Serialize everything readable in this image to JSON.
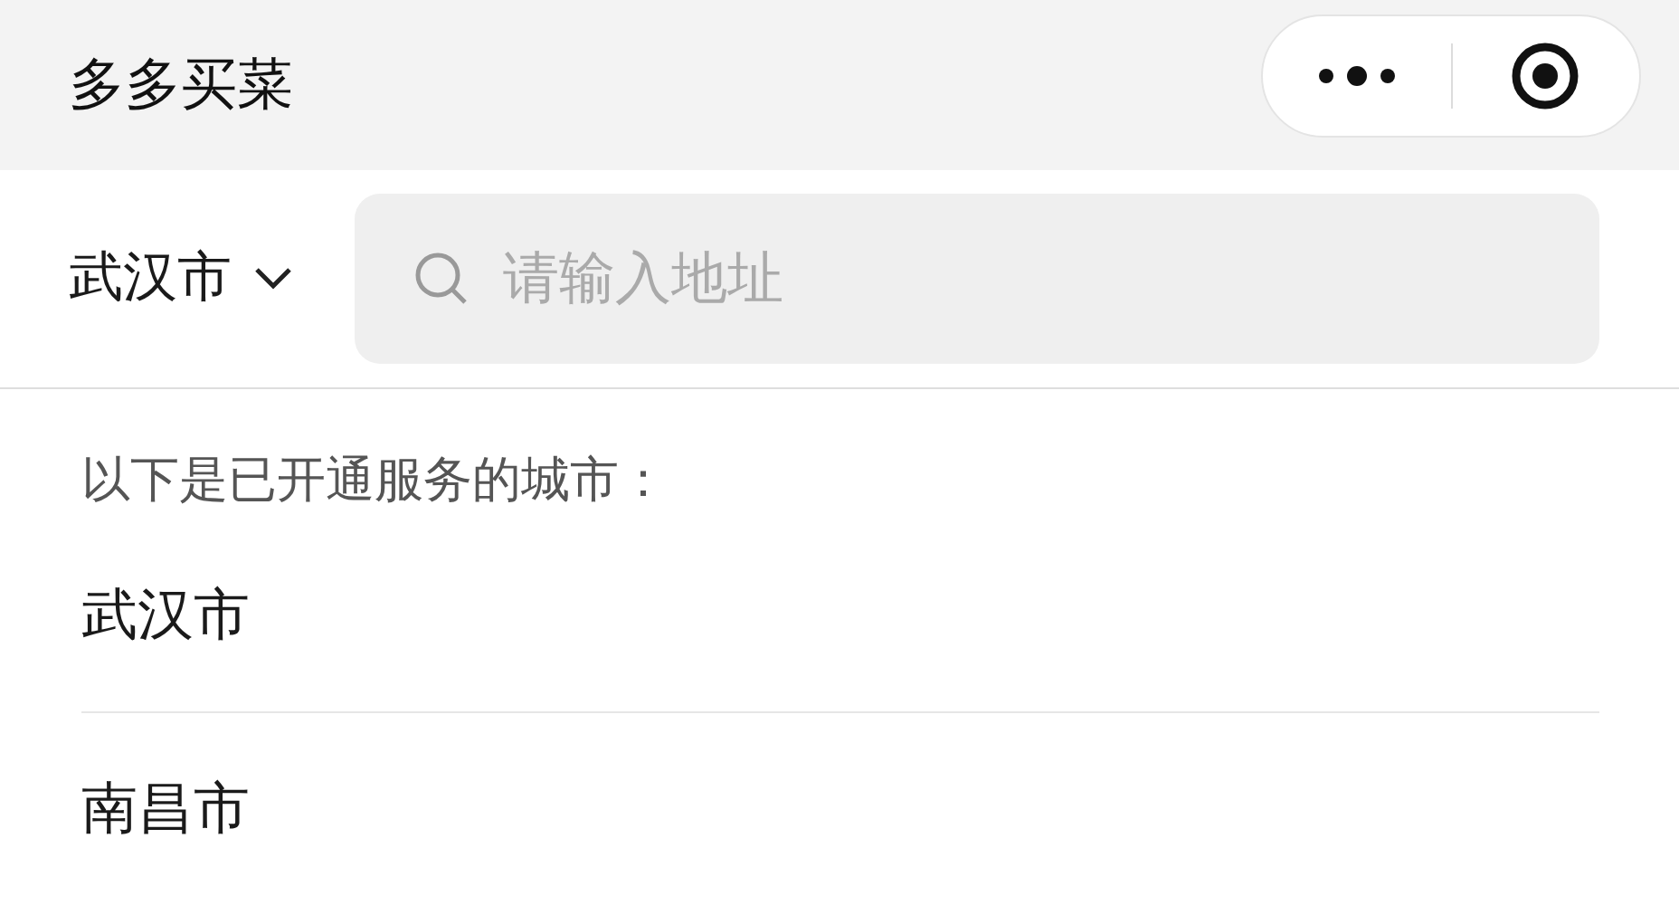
{
  "header": {
    "title": "多多买菜"
  },
  "city_selector": {
    "label": "武汉市"
  },
  "search": {
    "placeholder": "请输入地址"
  },
  "cities_heading": "以下是已开通服务的城市：",
  "cities": [
    {
      "name": "武汉市"
    },
    {
      "name": "南昌市"
    }
  ]
}
